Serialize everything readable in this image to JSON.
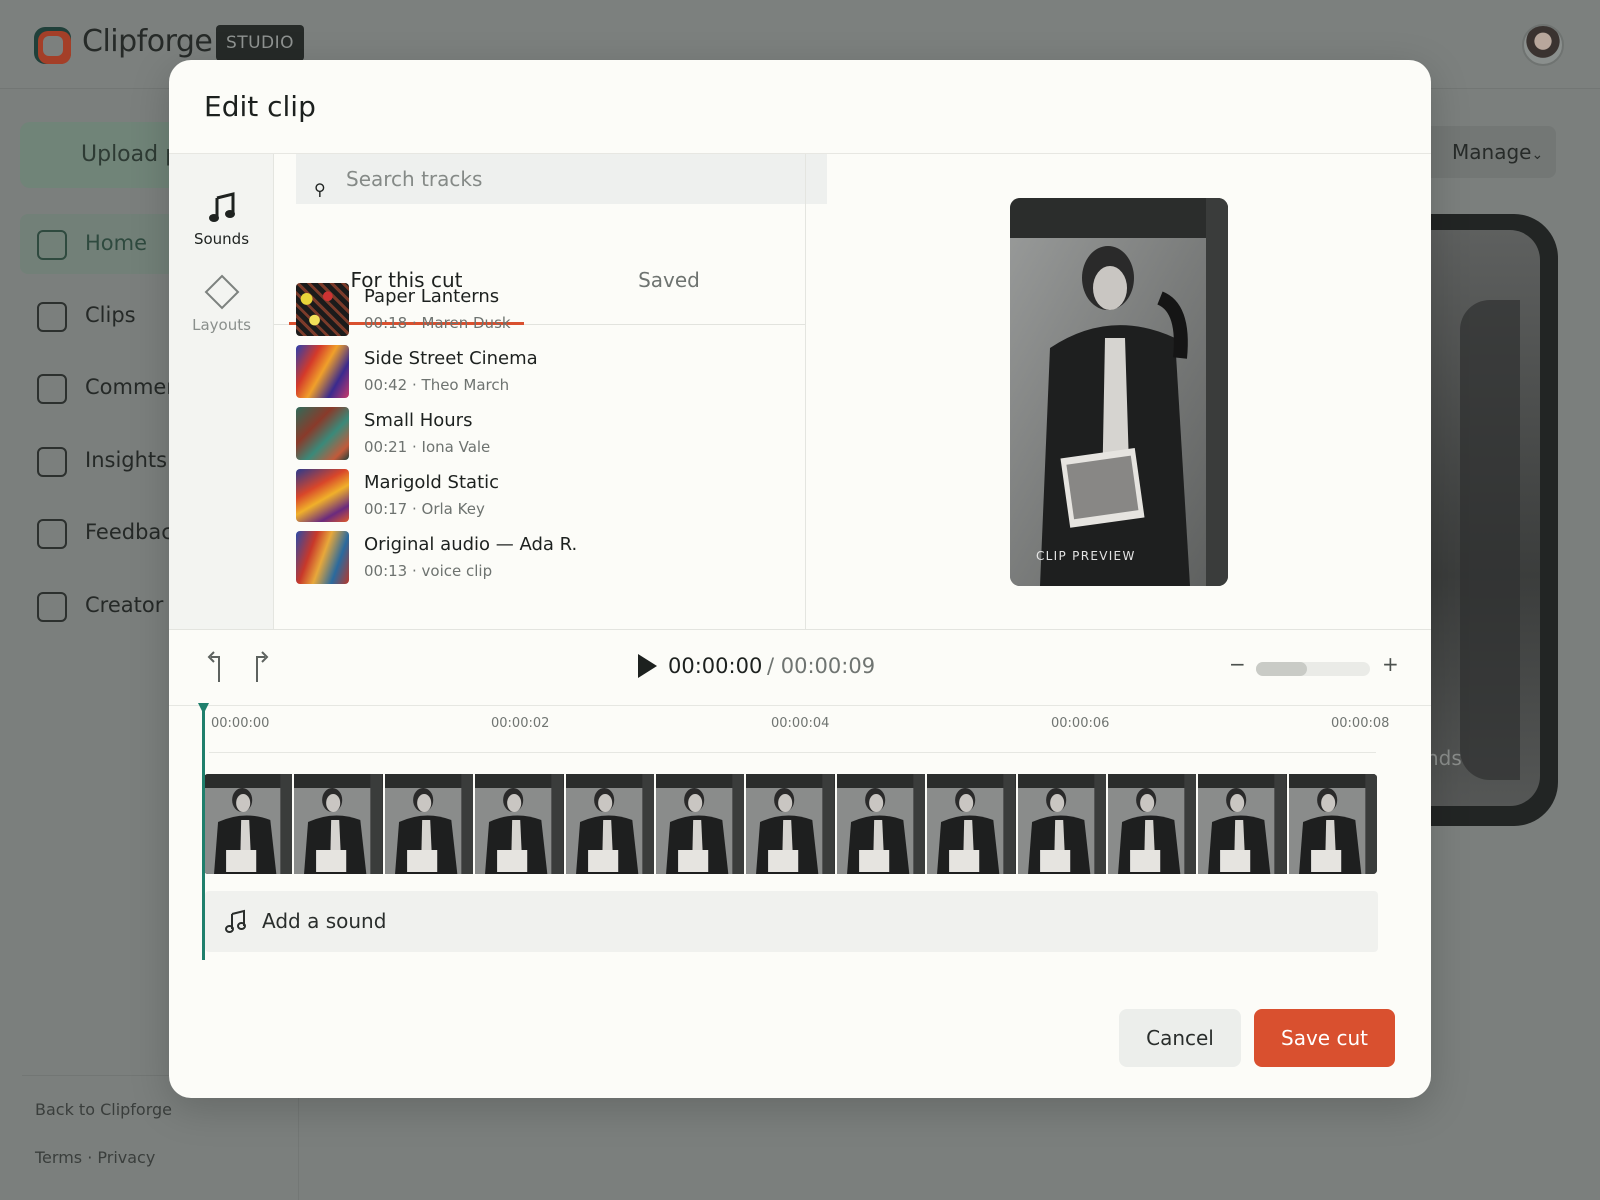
{
  "app": {
    "brand": "Clipforge",
    "badge": "STUDIO",
    "upload_label": "Upload pr",
    "manage_label": "Manage",
    "bg_phone_text": "nds"
  },
  "sidebar": {
    "items": [
      {
        "label": "Home",
        "active": true
      },
      {
        "label": "Clips"
      },
      {
        "label": "Commen"
      },
      {
        "label": "Insights"
      },
      {
        "label": "Feedbac"
      },
      {
        "label": "Creator g"
      }
    ],
    "footer_back": "Back to Clipforge",
    "footer_legal": "Terms · Privacy"
  },
  "modal": {
    "title": "Edit clip",
    "rail": {
      "sounds_label": "Sounds",
      "layouts_label": "Layouts"
    },
    "search": {
      "placeholder": "Search tracks",
      "value": ""
    },
    "tabs": [
      {
        "label": "For this cut",
        "active": true
      },
      {
        "label": "Saved"
      }
    ],
    "tracks": [
      {
        "title": "Paper Lanterns",
        "meta": "00:18 · Maren Dusk"
      },
      {
        "title": "Side Street Cinema",
        "meta": "00:42 · Theo March"
      },
      {
        "title": "Small Hours",
        "meta": "00:21 · Iona Vale"
      },
      {
        "title": "Marigold Static",
        "meta": "00:17 · Orla Key"
      },
      {
        "title": "Original audio — Ada R.",
        "meta": "00:13 · voice clip"
      }
    ],
    "preview_label": "CLIP PREVIEW",
    "player": {
      "current_time": "00:00:00",
      "total_time": "/ 00:00:09",
      "zoom_minus": "−",
      "zoom_plus": "+",
      "zoom_level": 0.45
    },
    "timeline": {
      "ticks": [
        "00:00:00",
        "00:00:02",
        "00:00:04",
        "00:00:06",
        "00:00:08"
      ],
      "add_sound_label": "Add a sound"
    },
    "buttons": {
      "cancel": "Cancel",
      "save": "Save cut"
    }
  },
  "colors": {
    "accent": "#d9502f",
    "playhead": "#1f7f6c",
    "overlay": "#7b7f7d"
  }
}
